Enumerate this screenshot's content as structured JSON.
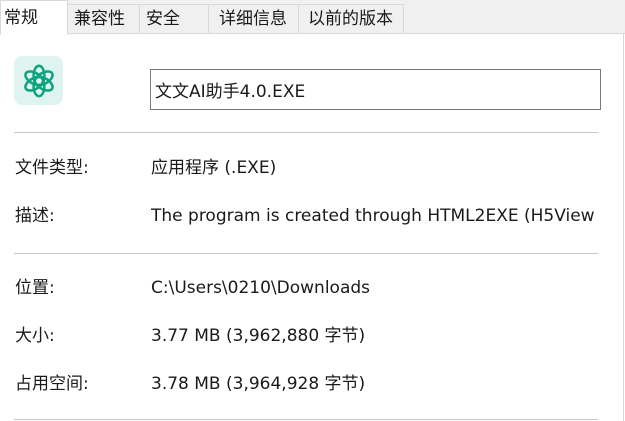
{
  "tabs": [
    {
      "label": "常规",
      "active": true
    },
    {
      "label": "兼容性",
      "active": false
    },
    {
      "label": "安全",
      "active": false
    },
    {
      "label": "详细信息",
      "active": false
    },
    {
      "label": "以前的版本",
      "active": false
    }
  ],
  "file": {
    "icon": "openai-logo-icon",
    "icon_color": "#10a37f",
    "name": "文文AI助手4.0.EXE"
  },
  "properties": {
    "type_label": "文件类型:",
    "type_value": "应用程序 (.EXE)",
    "desc_label": "描述:",
    "desc_value": "The program is created through HTML2EXE (H5View",
    "location_label": "位置:",
    "location_value": "C:\\Users\\0210\\Downloads",
    "size_label": "大小:",
    "size_value": "3.77 MB (3,962,880 字节)",
    "disk_size_label": "占用空间:",
    "disk_size_value": "3.78 MB (3,964,928 字节)"
  },
  "colors": {
    "tab_background": "#f0f0f0",
    "panel_background": "#ffffff",
    "separator": "#c8c8c8",
    "icon_background": "#dff3f1"
  }
}
